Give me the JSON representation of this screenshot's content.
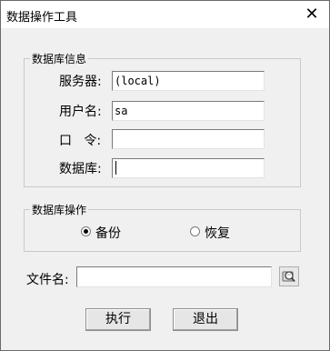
{
  "window": {
    "title": "数据操作工具",
    "close_glyph": "✕"
  },
  "db_info": {
    "group_title": "数据库信息",
    "server_label": "服务器:",
    "server_value": "(local)",
    "user_label": "用户名:",
    "user_value": "sa",
    "password_label": "口   令:",
    "password_value": "",
    "database_label": "数据库:",
    "database_value": ""
  },
  "db_ops": {
    "group_title": "数据库操作",
    "backup_label": "备份",
    "backup_selected": true,
    "restore_label": "恢复",
    "restore_selected": false
  },
  "file": {
    "label": "文件名:",
    "value": "",
    "browse_icon": "folder-search-icon"
  },
  "buttons": {
    "execute_label": "执行",
    "exit_label": "退出"
  }
}
